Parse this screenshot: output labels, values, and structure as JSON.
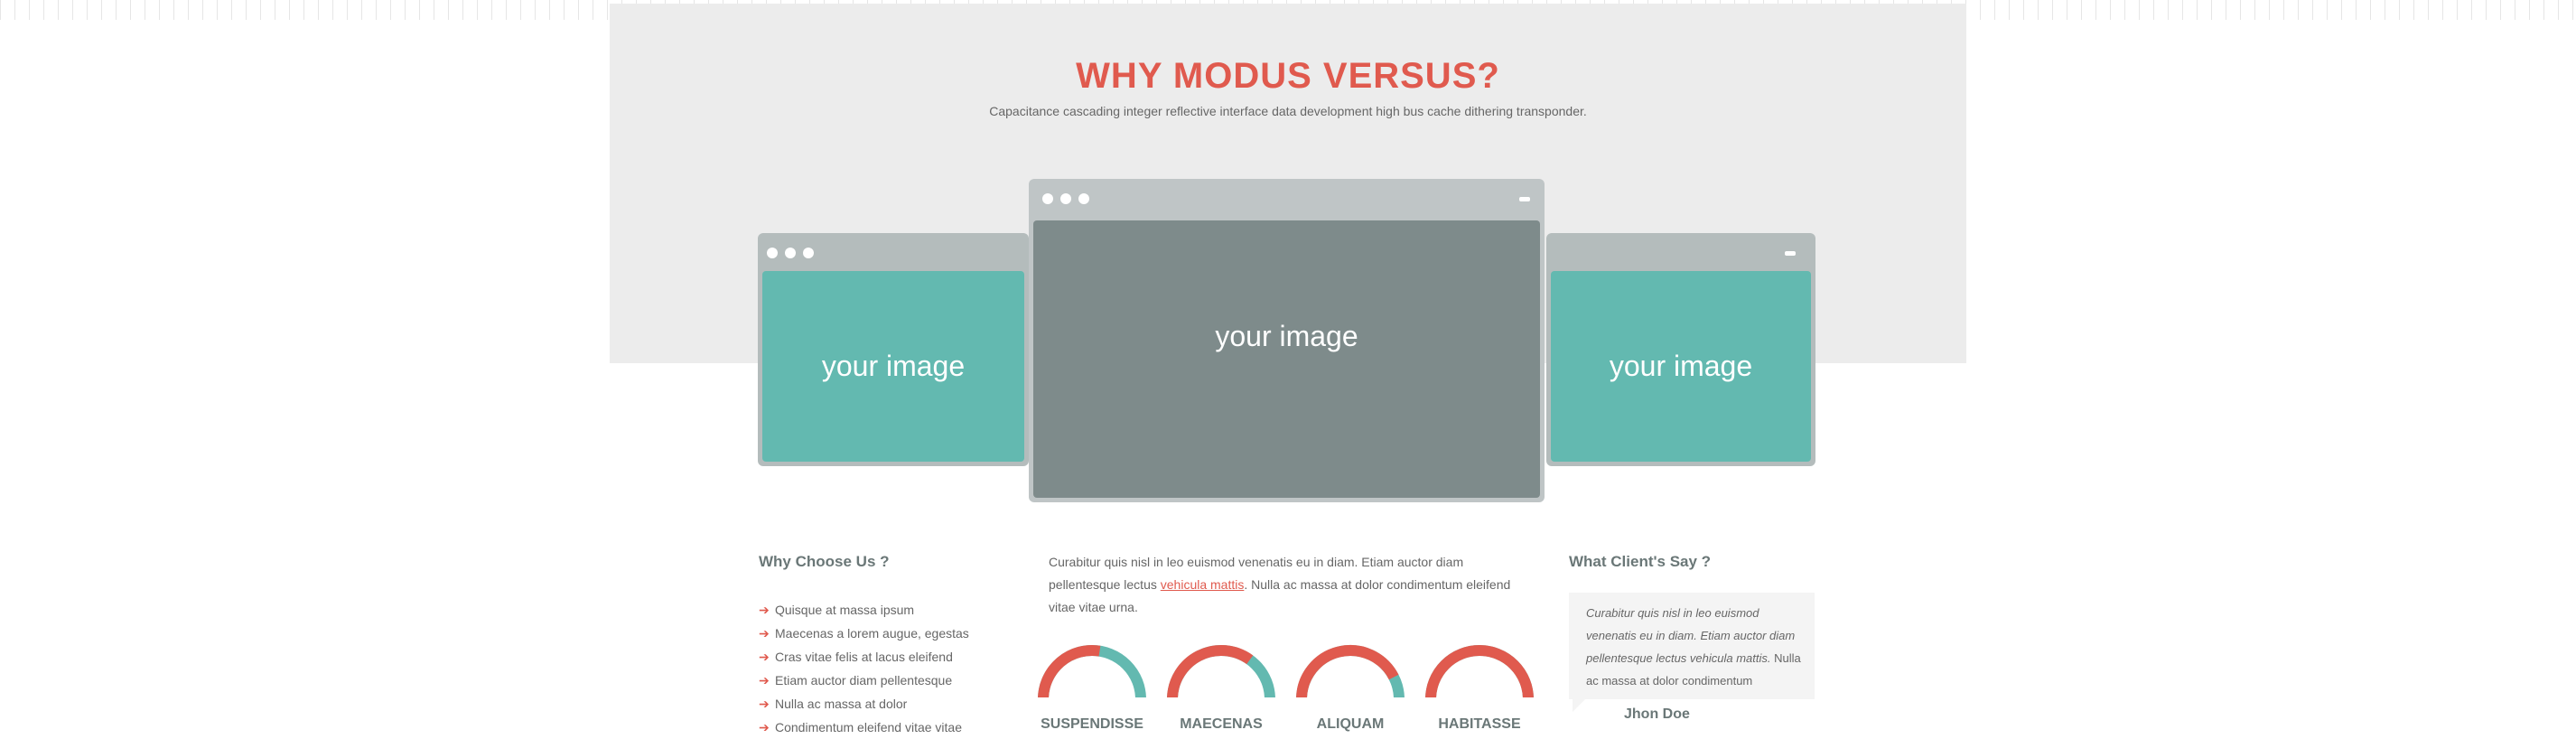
{
  "hero": {
    "title": "WHY MODUS VERSUS?",
    "subtitle": "Capacitance cascading integer reflective interface data development high bus cache dithering transponder."
  },
  "windows": {
    "left_label": "your image",
    "center_label": "your image",
    "right_label": "your image"
  },
  "why": {
    "heading": "Why Choose Us ?",
    "items": [
      "Quisque at massa ipsum",
      "Maecenas a lorem augue, egestas",
      "Cras vitae felis at lacus eleifend",
      "Etiam auctor diam pellentesque",
      "Nulla ac massa at dolor",
      "Condimentum eleifend vitae vitae"
    ]
  },
  "middle": {
    "text_before": "Curabitur quis nisl in leo euismod venenatis eu in diam. Etiam auctor diam pellentesque lectus ",
    "link": "vehicula mattis",
    "text_after": ". Nulla ac massa at dolor condimentum eleifend vitae vitae urna.",
    "gauges": [
      {
        "label": "SUSPENDISSE",
        "value": 0.55
      },
      {
        "label": "MAECENAS",
        "value": 0.7
      },
      {
        "label": "ALIQUAM",
        "value": 0.85
      },
      {
        "label": "HABITASSE",
        "value": 1.0
      }
    ]
  },
  "clients": {
    "heading": "What Client's Say ?",
    "quote_italic": "Curabitur quis nisl in leo euismod venenatis eu in diam. Etiam auctor diam pellentesque lectus vehicula mattis.",
    "quote_rest": " Nulla ac massa at dolor condimentum",
    "author": "Jhon Doe"
  },
  "colors": {
    "accent": "#e05a4e",
    "teal": "#63b9b0",
    "gray": "#7e8b8b"
  }
}
